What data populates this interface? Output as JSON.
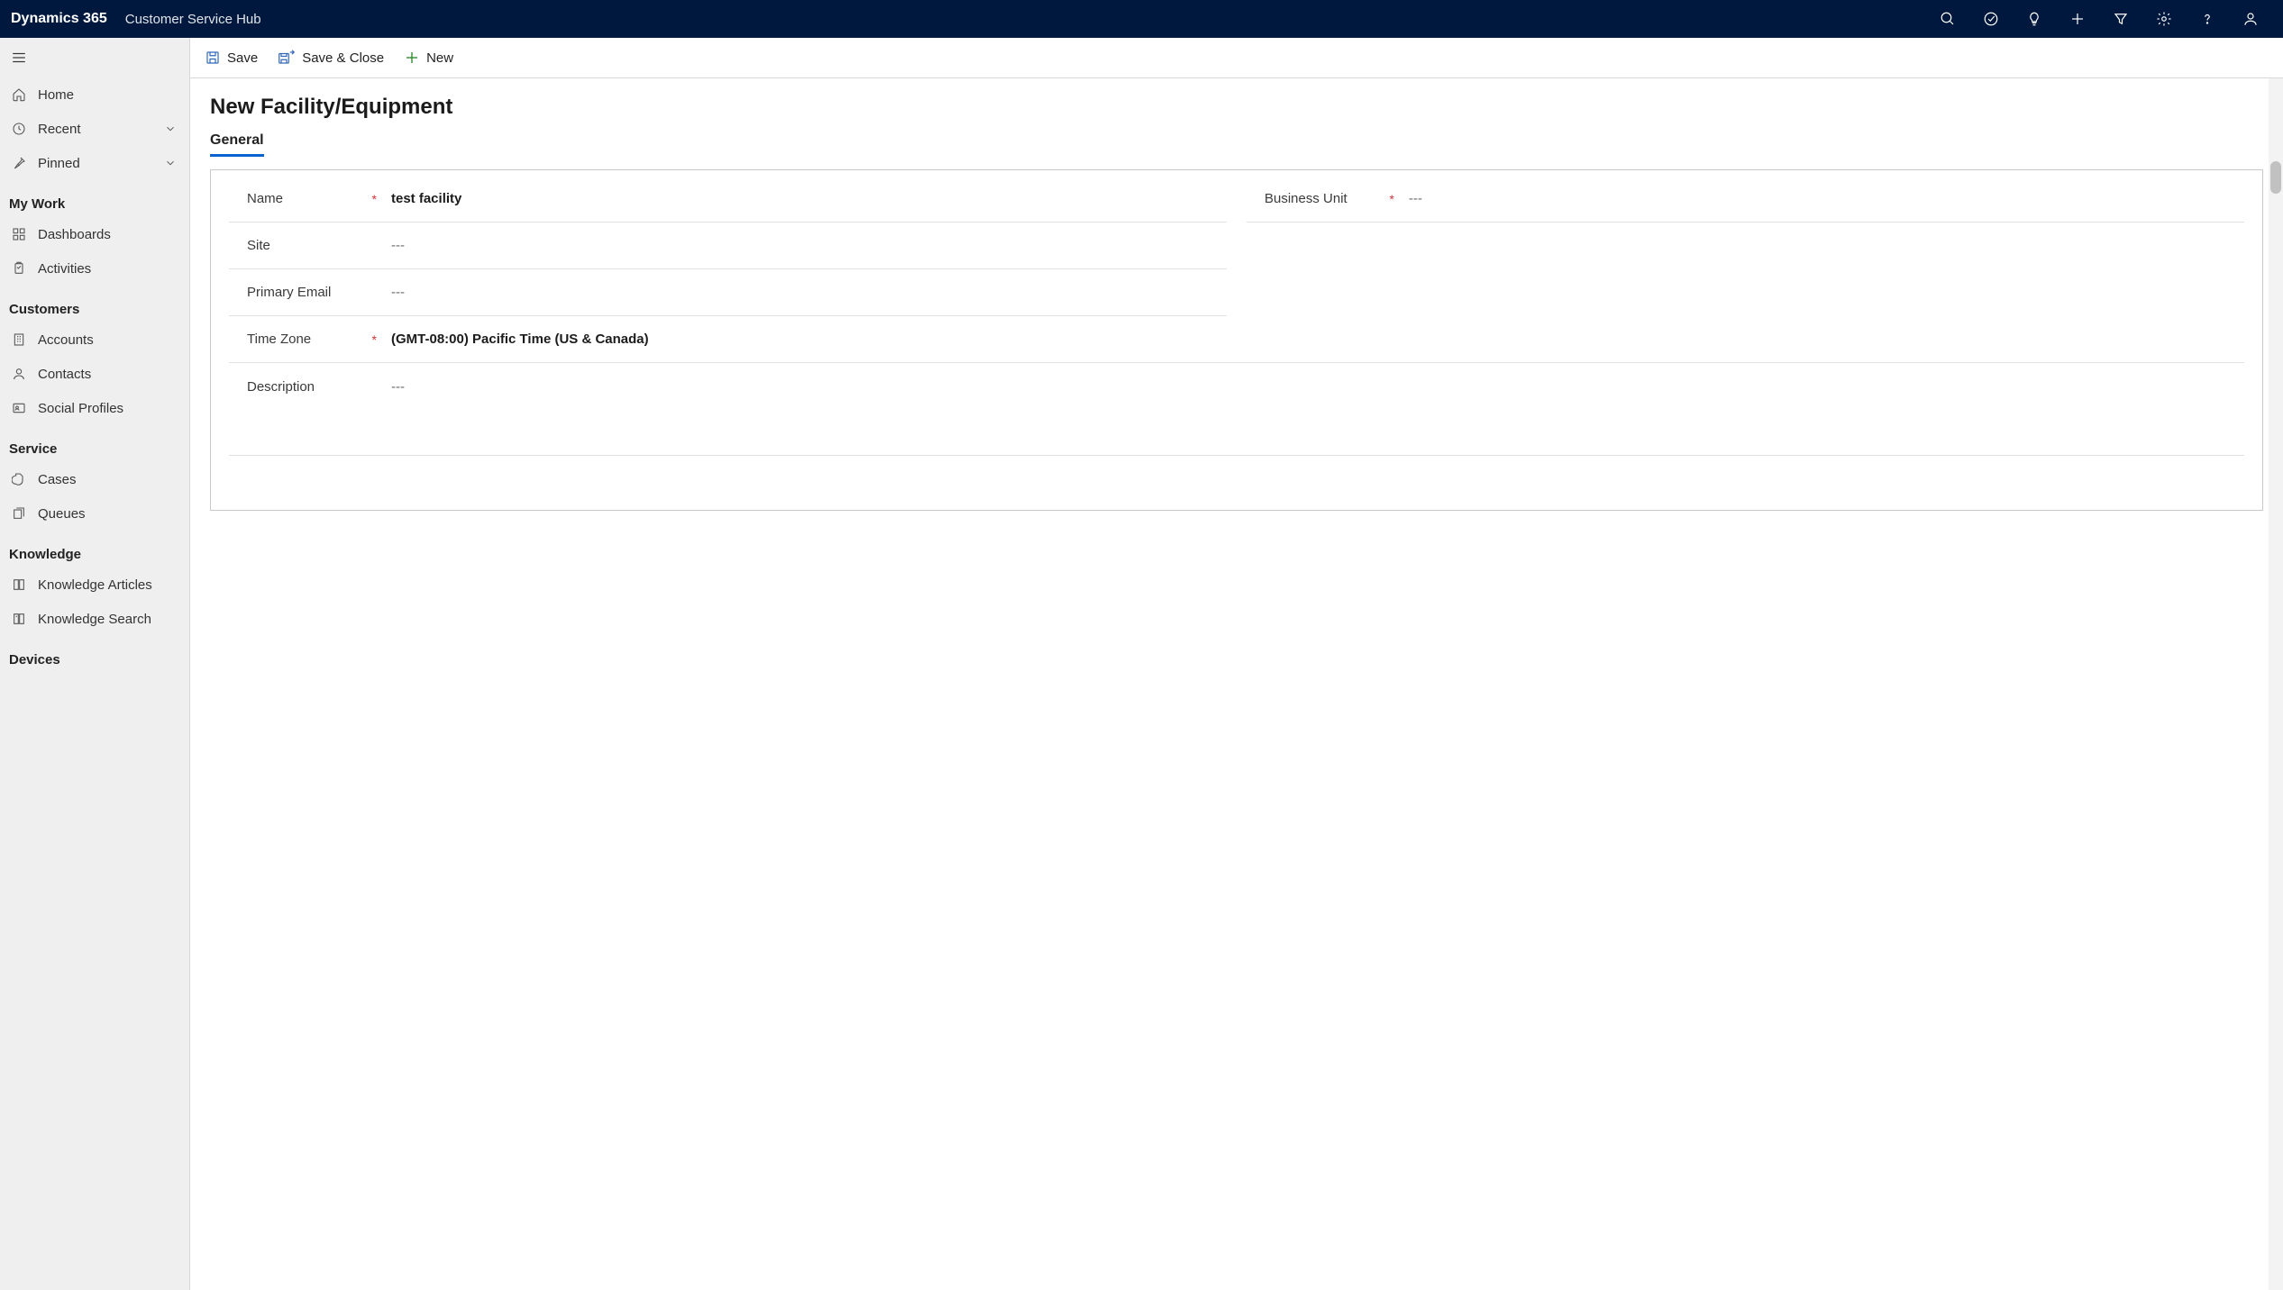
{
  "topbar": {
    "brand": "Dynamics 365",
    "hub": "Customer Service Hub"
  },
  "cmdbar": {
    "save": "Save",
    "save_close": "Save & Close",
    "new": "New"
  },
  "nav": {
    "home": "Home",
    "recent": "Recent",
    "pinned": "Pinned",
    "groups": [
      {
        "label": "My Work",
        "items": [
          "Dashboards",
          "Activities"
        ]
      },
      {
        "label": "Customers",
        "items": [
          "Accounts",
          "Contacts",
          "Social Profiles"
        ]
      },
      {
        "label": "Service",
        "items": [
          "Cases",
          "Queues"
        ]
      },
      {
        "label": "Knowledge",
        "items": [
          "Knowledge Articles",
          "Knowledge Search"
        ]
      },
      {
        "label": "Devices",
        "items": []
      }
    ]
  },
  "page": {
    "title": "New Facility/Equipment",
    "tab_general": "General"
  },
  "form": {
    "name_label": "Name",
    "name_value": "test facility",
    "site_label": "Site",
    "site_value": "---",
    "email_label": "Primary Email",
    "email_value": "---",
    "tz_label": "Time Zone",
    "tz_value": "(GMT-08:00) Pacific Time (US & Canada)",
    "desc_label": "Description",
    "desc_value": "---",
    "bu_label": "Business Unit",
    "bu_value": "---"
  }
}
